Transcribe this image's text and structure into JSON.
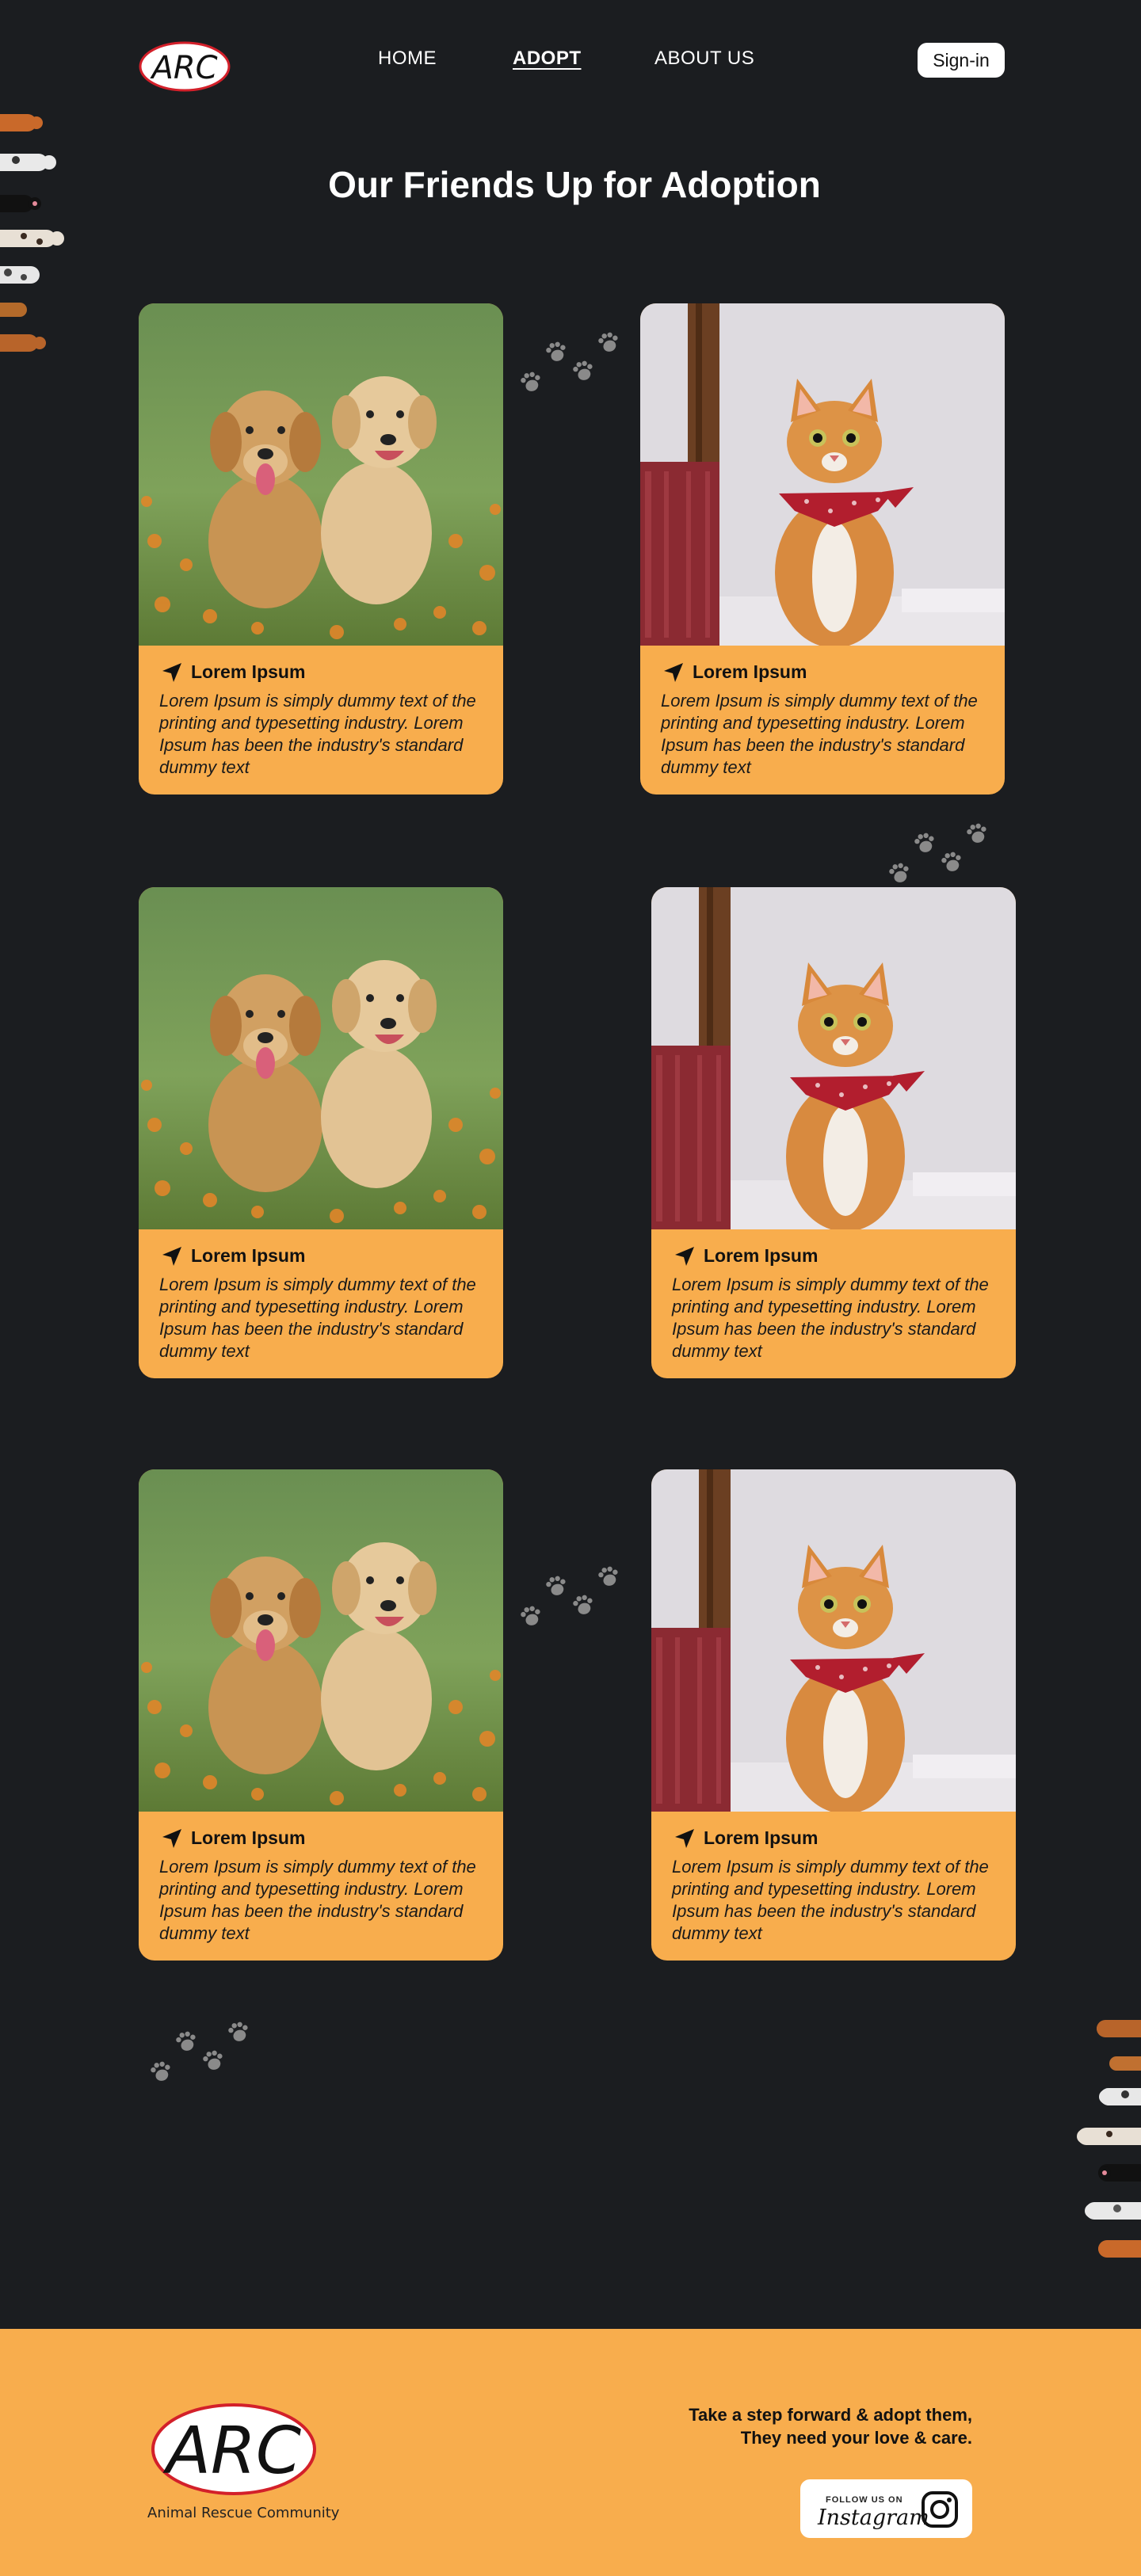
{
  "header": {
    "logo_text": "ARC",
    "nav": [
      "HOME",
      "ADOPT",
      "ABOUT US"
    ],
    "signin_label": "Sign-in"
  },
  "page_title": "Our Friends Up for Adoption",
  "cards": [
    {
      "name": "Lorem Ipsum",
      "desc": "Lorem Ipsum is simply dummy text of the printing and typesetting industry. Lorem Ipsum has been the industry's standard dummy text",
      "animal": "puppies"
    },
    {
      "name": "Lorem Ipsum",
      "desc": "Lorem Ipsum is simply dummy text of the printing and typesetting industry. Lorem Ipsum has been the industry's standard dummy text",
      "animal": "cat"
    },
    {
      "name": "Lorem Ipsum",
      "desc": "Lorem Ipsum is simply dummy text of the printing and typesetting industry. Lorem Ipsum has been the industry's standard dummy text",
      "animal": "puppies"
    },
    {
      "name": "Lorem Ipsum",
      "desc": "Lorem Ipsum is simply dummy text of the printing and typesetting industry. Lorem Ipsum has been the industry's standard dummy text",
      "animal": "cat"
    },
    {
      "name": "Lorem Ipsum",
      "desc": "Lorem Ipsum is simply dummy text of the printing and typesetting industry. Lorem Ipsum has been the industry's standard dummy text",
      "animal": "puppies"
    },
    {
      "name": "Lorem Ipsum",
      "desc": "Lorem Ipsum is simply dummy text of the printing and typesetting industry. Lorem Ipsum has been the industry's standard dummy text",
      "animal": "cat"
    }
  ],
  "footer": {
    "logo_text": "ARC",
    "logo_subtitle": "Animal Rescue Community",
    "tagline_line1": "Take a step forward & adopt them,",
    "tagline_line2": "They need your love & care.",
    "instagram_small": "FOLLOW US ON",
    "instagram_big": "Instagram"
  },
  "colors": {
    "background": "#1b1d20",
    "accent": "#f8ad4d",
    "paw": "#8a8a8a"
  },
  "icons": [
    "paw-print-icon",
    "navigation-arrow-icon",
    "instagram-icon"
  ]
}
